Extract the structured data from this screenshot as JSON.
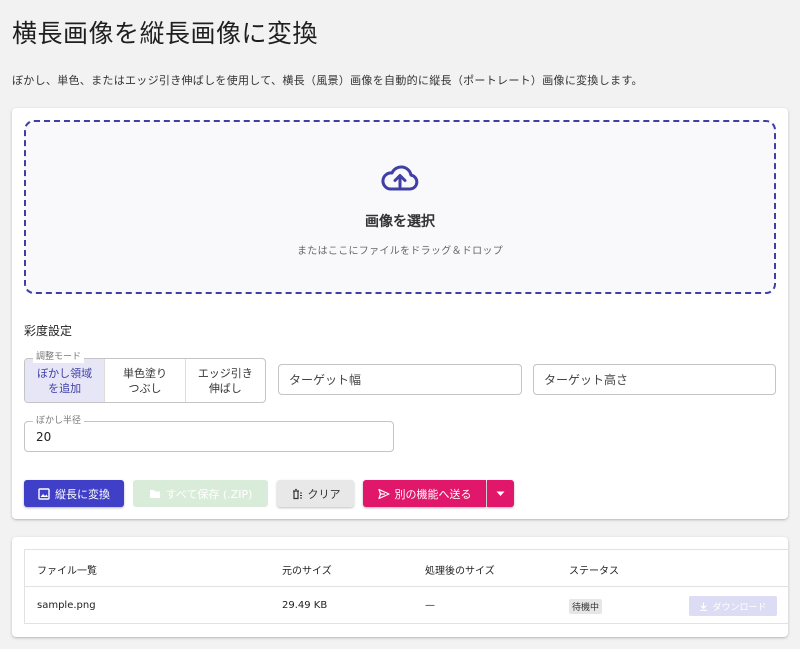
{
  "page": {
    "title": "横長画像を縦長画像に変換",
    "description": "ぼかし、単色、またはエッジ引き伸ばしを使用して、横長（風景）画像を自動的に縦長（ポートレート）画像に変換します。"
  },
  "dropzone": {
    "icon": "cloud-upload-icon",
    "title": "画像を選択",
    "subtitle": "またはここにファイルをドラッグ＆ドロップ"
  },
  "settings": {
    "section_label": "彩度設定",
    "mode_legend": "調整モード",
    "modes": [
      {
        "label_line1": "ぼかし領域",
        "label_line2": "を追加",
        "selected": true
      },
      {
        "label_line1": "単色塗り",
        "label_line2": "つぶし",
        "selected": false
      },
      {
        "label_line1": "エッジ引き",
        "label_line2": "伸ばし",
        "selected": false
      }
    ],
    "target_width_placeholder": "ターゲット幅",
    "target_height_placeholder": "ターゲット高さ",
    "blur_radius_legend": "ぼかし半径",
    "blur_radius_value": "20"
  },
  "actions": {
    "convert_label": "縦長に変換",
    "save_all_label": "すべて保存 (.ZIP)",
    "clear_label": "クリア",
    "send_label": "別の機能へ送る"
  },
  "file_table": {
    "headers": [
      "ファイル一覧",
      "元のサイズ",
      "処理後のサイズ",
      "ステータス"
    ],
    "rows": [
      {
        "name": "sample.png",
        "original_size": "29.49 KB",
        "processed_size": "—",
        "status": "待機中",
        "download_label": "ダウンロード"
      }
    ]
  },
  "colors": {
    "primary": "#3f3fc8",
    "accent": "#e0176a",
    "dropzone_border": "#3f3fa6"
  }
}
